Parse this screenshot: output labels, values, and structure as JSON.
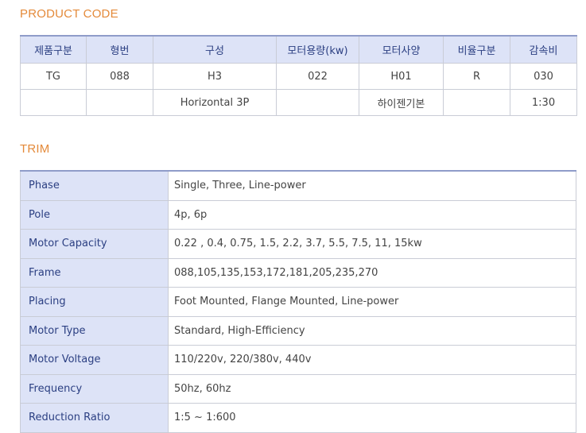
{
  "product_code": {
    "title": "PRODUCT CODE",
    "headers": [
      "제품구분",
      "형번",
      "구성",
      "모터용량(kw)",
      "모터사양",
      "비율구분",
      "감속비"
    ],
    "rows": [
      [
        "TG",
        "088",
        "H3",
        "022",
        "H01",
        "R",
        "030"
      ],
      [
        "",
        "",
        "Horizontal 3P",
        "",
        "하이젠기본",
        "",
        "1:30"
      ]
    ]
  },
  "trim": {
    "title": "TRIM",
    "rows": [
      {
        "label": "Phase",
        "value": "Single, Three, Line-power"
      },
      {
        "label": "Pole",
        "value": "4p, 6p"
      },
      {
        "label": "Motor Capacity",
        "value": "0.22 , 0.4, 0.75, 1.5, 2.2, 3.7, 5.5, 7.5, 11, 15kw"
      },
      {
        "label": "Frame",
        "value": "088,105,135,153,172,181,205,235,270"
      },
      {
        "label": "Placing",
        "value": "Foot Mounted, Flange Mounted, Line-power"
      },
      {
        "label": "Motor Type",
        "value": "Standard, High-Efficiency"
      },
      {
        "label": "Motor Voltage",
        "value": "110/220v, 220/380v, 440v"
      },
      {
        "label": "Frequency",
        "value": "50hz, 60hz"
      },
      {
        "label": "Reduction Ratio",
        "value": "1:5 ~ 1:600"
      }
    ]
  }
}
